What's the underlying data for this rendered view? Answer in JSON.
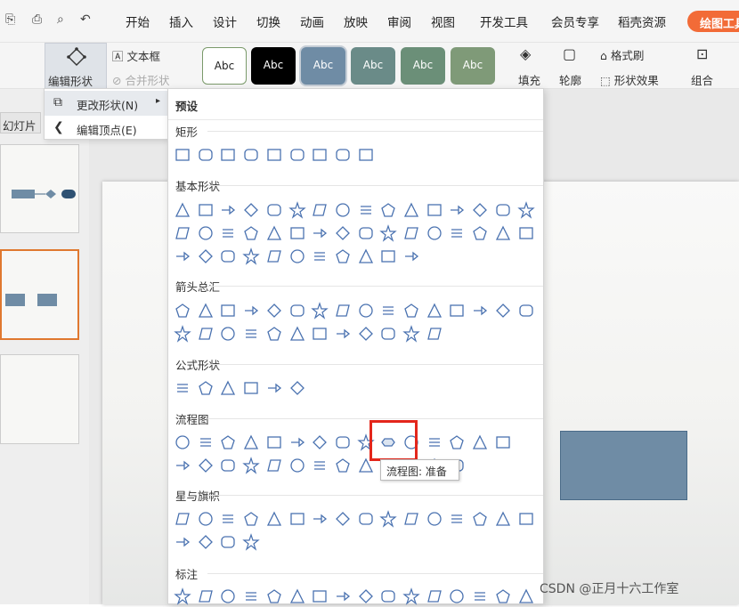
{
  "tabs": [
    "开始",
    "插入",
    "设计",
    "切换",
    "动画",
    "放映",
    "审阅",
    "视图",
    "开发工具",
    "会员专享",
    "稻壳资源",
    "绘图工具"
  ],
  "ribbon": {
    "edit_shape": "编辑形状",
    "text_box": "文本框",
    "merge_shape": "合并形状",
    "style_labels": [
      "Abc",
      "Abc",
      "Abc",
      "Abc",
      "Abc",
      "Abc"
    ],
    "fill": "填充",
    "outline": "轮廓",
    "format_brush": "格式刷",
    "shape_effect": "形状效果",
    "group": "组合"
  },
  "left_panel": {
    "slides_tab": "幻灯片"
  },
  "submenu": {
    "change_shape": "更改形状(N)",
    "edit_points": "编辑顶点(E)"
  },
  "gallery": {
    "preset": "预设",
    "sections": [
      {
        "title": "矩形",
        "count": 9
      },
      {
        "title": "基本形状",
        "count": 43
      },
      {
        "title": "箭头总汇",
        "count": 28
      },
      {
        "title": "公式形状",
        "count": 6
      },
      {
        "title": "流程图",
        "count": 28
      },
      {
        "title": "星与旗帜",
        "count": 20
      },
      {
        "title": "标注",
        "count": 16
      }
    ]
  },
  "tooltip": "流程图: 准备",
  "watermark": "CSDN @正月十六工作室",
  "colors": {
    "accent": "#f26b37",
    "icon": "#4a72b0",
    "shape_fill": "#6f8ca5",
    "highlight": "#e3261b"
  },
  "icons": [
    "save-icon",
    "print-icon",
    "preview-icon",
    "undo-icon",
    "edit-shape-icon",
    "text-box-icon",
    "change-shape-icon",
    "edit-points-icon",
    "fill-icon",
    "outline-icon",
    "format-brush-icon",
    "shape-effect-icon",
    "group-icon"
  ]
}
